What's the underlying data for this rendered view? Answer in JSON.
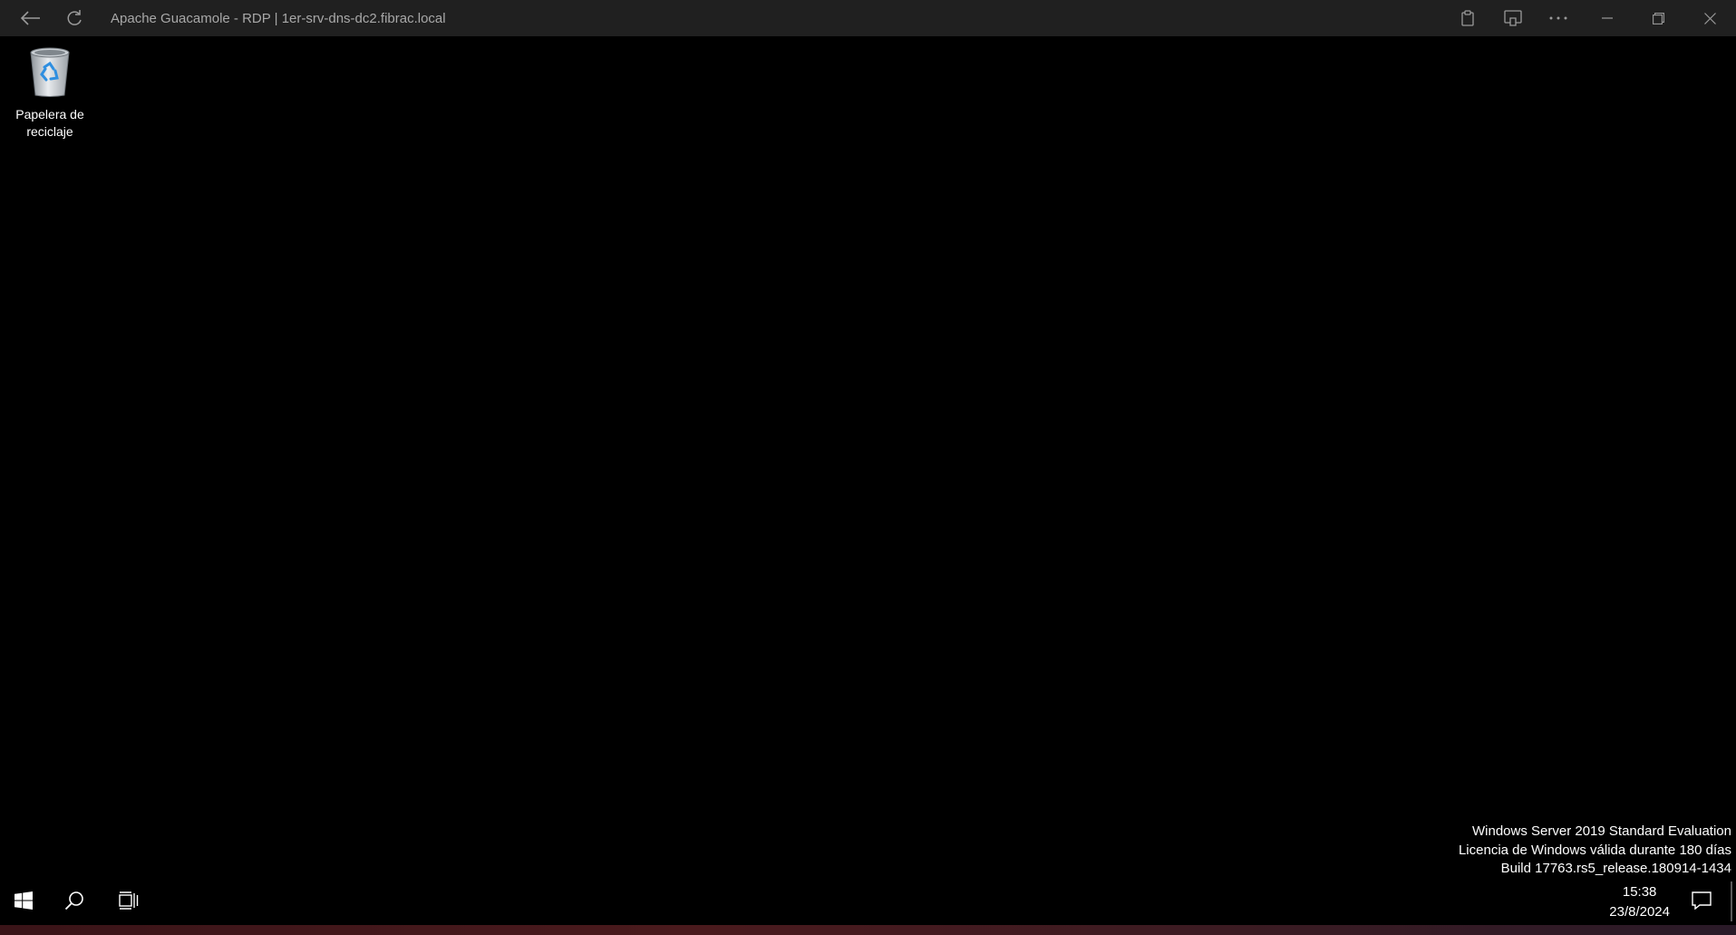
{
  "titlebar": {
    "title": "Apache Guacamole - RDP | 1er-srv-dns-dc2.fibrac.local",
    "back_icon": "arrow-left-icon",
    "refresh_icon": "refresh-icon",
    "right_icons": [
      "clipboard-icon",
      "cast-icon",
      "more-icon",
      "minimize-icon",
      "restore-icon",
      "close-icon"
    ]
  },
  "desktop": {
    "icons": [
      {
        "label": "Papelera de reciclaje",
        "icon": "recycle-bin-icon"
      }
    ],
    "watermark": {
      "line1": "Windows Server 2019 Standard Evaluation",
      "line2": "Licencia de Windows válida durante 180 días",
      "line3": "Build 17763.rs5_release.180914-1434"
    }
  },
  "taskbar": {
    "icons": [
      "windows-start-icon",
      "search-icon",
      "task-view-icon"
    ],
    "clock": {
      "time": "15:38",
      "date": "23/8/2024"
    },
    "notification_icon": "notification-icon"
  },
  "colors": {
    "titlebar_bg": "#202020",
    "desktop_bg": "#000000",
    "title_text": "#a8a8a8",
    "text": "#ffffff"
  }
}
